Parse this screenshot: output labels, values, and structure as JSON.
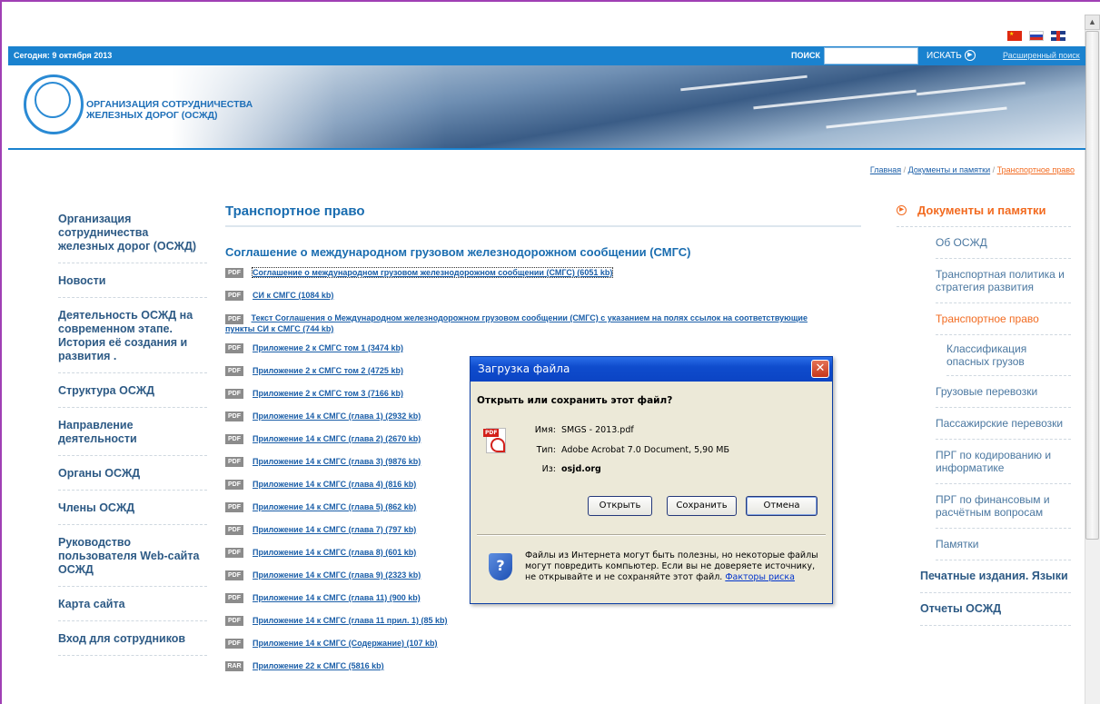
{
  "topbar": {
    "date": "Сегодня: 9 октября 2013",
    "search_label": "ПОИСК",
    "search_value": "",
    "search_button": "ИСКАТЬ",
    "advanced_search": "Расширенный поиск"
  },
  "logo": {
    "line1": "ОРГАНИЗАЦИЯ СОТРУДНИЧЕСТВА",
    "line2": "ЖЕЛЕЗНЫХ ДОРОГ (ОСЖД)"
  },
  "breadcrumb": {
    "home": "Главная",
    "section": "Документы и памятки",
    "current": "Транспортное право",
    "separator": "/"
  },
  "left_nav": [
    "Организация сотрудничества железных дорог (ОСЖД)",
    "Новости",
    "Деятельность ОСЖД на современном этапе. История её создания и развития .",
    "Структура ОСЖД",
    "Направление деятельности",
    "Органы ОСЖД",
    "Члены ОСЖД",
    "Руководство пользователя Web-сайта ОСЖД",
    "Карта сайта",
    "Вход для сотрудников"
  ],
  "content": {
    "title": "Транспортное право",
    "subtitle": "Соглашение о международном грузовом железнодорожном сообщении (СМГС)",
    "documents": [
      {
        "type": "PDF",
        "label": "Соглашение о международном грузовом железнодорожном сообщении (СМГС) (6051 kb)"
      },
      {
        "type": "PDF",
        "label": "СИ к СМГС (1084 kb)"
      },
      {
        "type": "PDF",
        "label": "Текст Соглашения о Международном железнодорожном грузовом сообщении (СМГС) с указанием на полях ссылок на соответствующие",
        "label2": "пункты СИ к СМГС (744 kb)"
      },
      {
        "type": "PDF",
        "label": "Приложение 2 к СМГС том 1 (3474 kb)"
      },
      {
        "type": "PDF",
        "label": "Приложение 2 к СМГС том 2 (4725 kb)"
      },
      {
        "type": "PDF",
        "label": "Приложение 2 к СМГС том 3 (7166 kb)"
      },
      {
        "type": "PDF",
        "label": "Приложение 14 к СМГС (глава 1) (2932 kb)"
      },
      {
        "type": "PDF",
        "label": "Приложение 14 к СМГС (глава 2) (2670 kb)"
      },
      {
        "type": "PDF",
        "label": "Приложение 14 к СМГС (глава 3) (9876 kb)"
      },
      {
        "type": "PDF",
        "label": "Приложение 14 к СМГС (глава 4) (816 kb)"
      },
      {
        "type": "PDF",
        "label": "Приложение 14 к СМГС (глава 5) (862 kb)"
      },
      {
        "type": "PDF",
        "label": "Приложение 14 к СМГС (глава 7) (797 kb)"
      },
      {
        "type": "PDF",
        "label": "Приложение 14 к СМГС (глава 8) (601 kb)"
      },
      {
        "type": "PDF",
        "label": "Приложение 14 к СМГС (глава 9) (2323 kb)"
      },
      {
        "type": "PDF",
        "label": "Приложение 14 к СМГС (глава 11) (900 kb)"
      },
      {
        "type": "PDF",
        "label": "Приложение 14 к СМГС (глава 11 прил. 1) (85 kb)"
      },
      {
        "type": "PDF",
        "label": "Приложение 14 к СМГС (Содержание) (107 kb)"
      },
      {
        "type": "RAR",
        "label": "Приложение 22 к СМГС (5816 kb)"
      }
    ]
  },
  "right_nav": {
    "head": "Документы и памятки",
    "items": [
      {
        "label": "Об ОСЖД",
        "level": "sub"
      },
      {
        "label": "Транспортная политика и стратегия развития",
        "level": "sub"
      },
      {
        "label": "Транспортное право",
        "level": "sub",
        "active": true
      },
      {
        "label": "Классификация опасных грузов",
        "level": "subsub"
      },
      {
        "label": "Грузовые перевозки",
        "level": "sub"
      },
      {
        "label": "Пассажирские перевозки",
        "level": "sub"
      },
      {
        "label": "ПРГ по кодированию и информатике",
        "level": "sub"
      },
      {
        "label": "ПРГ по финансовым и расчётным вопросам",
        "level": "sub"
      },
      {
        "label": "Памятки",
        "level": "sub"
      },
      {
        "label": "Печатные издания. Языки",
        "level": "main"
      },
      {
        "label": "Отчеты ОСЖД",
        "level": "main"
      }
    ]
  },
  "dialog": {
    "title": "Загрузка файла",
    "close": "✕",
    "question": "Открыть или сохранить этот файл?",
    "name_label": "Имя:",
    "name_value": "SMGS - 2013.pdf",
    "type_label": "Тип:",
    "type_value": "Adobe Acrobat 7.0 Document, 5,90 МБ",
    "from_label": "Из:",
    "from_value": "osjd.org",
    "open_button": "Открыть",
    "save_button": "Сохранить",
    "cancel_button": "Отмена",
    "warning": "Файлы из Интернета могут быть полезны, но некоторые файлы могут повредить компьютер. Если вы не доверяете источнику, не открывайте и не сохраняйте этот файл.",
    "risk_link": "Факторы риска"
  },
  "colors": {
    "brand_blue": "#1a82cf",
    "link_blue": "#1a5ea8",
    "accent_orange": "#f26b21",
    "nav_text": "#2d5a85",
    "frame_purple": "#a03fb4"
  }
}
